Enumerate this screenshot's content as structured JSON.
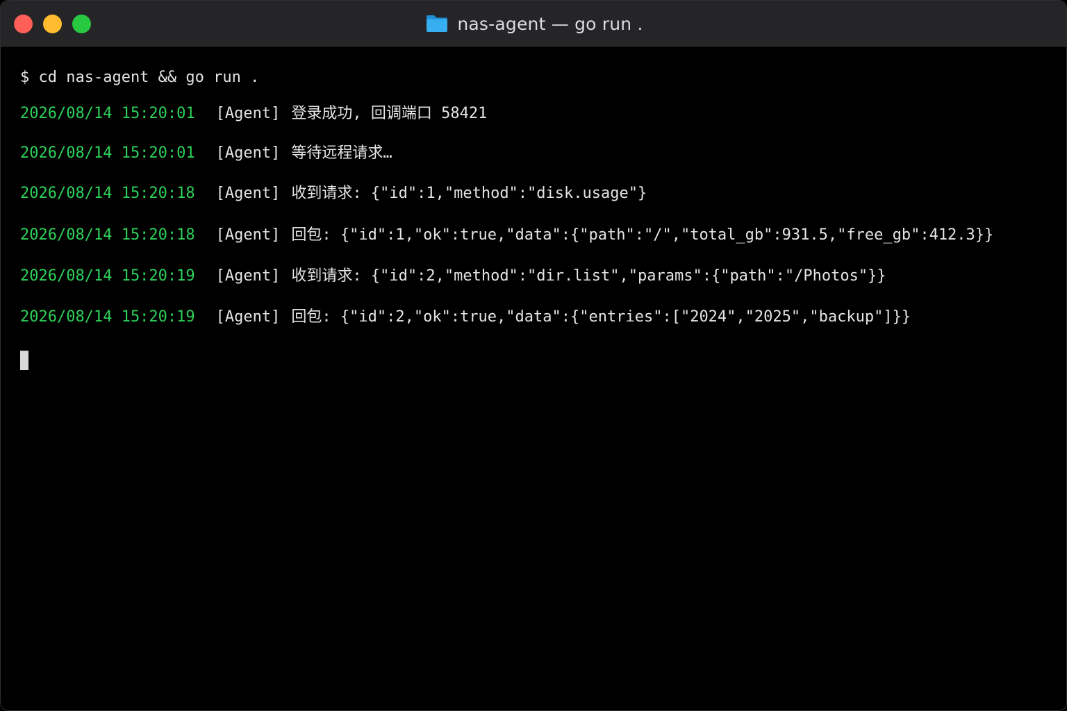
{
  "window": {
    "title": "nas-agent — go run .",
    "folder_icon": "folder-icon",
    "controls": {
      "close_color": "#ff5f57",
      "minimize_color": "#febc2e",
      "zoom_color": "#28c840"
    }
  },
  "terminal": {
    "prompt": "$ cd nas-agent && go run .",
    "timestamp_color": "#2ed15a",
    "logs": [
      {
        "ts": "2026/08/14 15:20:01",
        "tag": "[Agent]",
        "msg": "登录成功, 回调端口 58421"
      },
      {
        "ts": "2026/08/14 15:20:01",
        "tag": "[Agent]",
        "msg": "等待远程请求…"
      },
      {
        "ts": "2026/08/14 15:20:18",
        "tag": "[Agent]",
        "msg": "收到请求: {\"id\":1,\"method\":\"disk.usage\"}"
      },
      {
        "ts": "2026/08/14 15:20:18",
        "tag": "[Agent]",
        "msg": "回包: {\"id\":1,\"ok\":true,\"data\":{\"path\":\"/\",\"total_gb\":931.5,\"free_gb\":412.3}}"
      },
      {
        "ts": "2026/08/14 15:20:19",
        "tag": "[Agent]",
        "msg": "收到请求: {\"id\":2,\"method\":\"dir.list\",\"params\":{\"path\":\"/Photos\"}}"
      },
      {
        "ts": "2026/08/14 15:20:19",
        "tag": "[Agent]",
        "msg": "回包: {\"id\":2,\"ok\":true,\"data\":{\"entries\":[\"2024\",\"2025\",\"backup\"]}}"
      }
    ]
  }
}
